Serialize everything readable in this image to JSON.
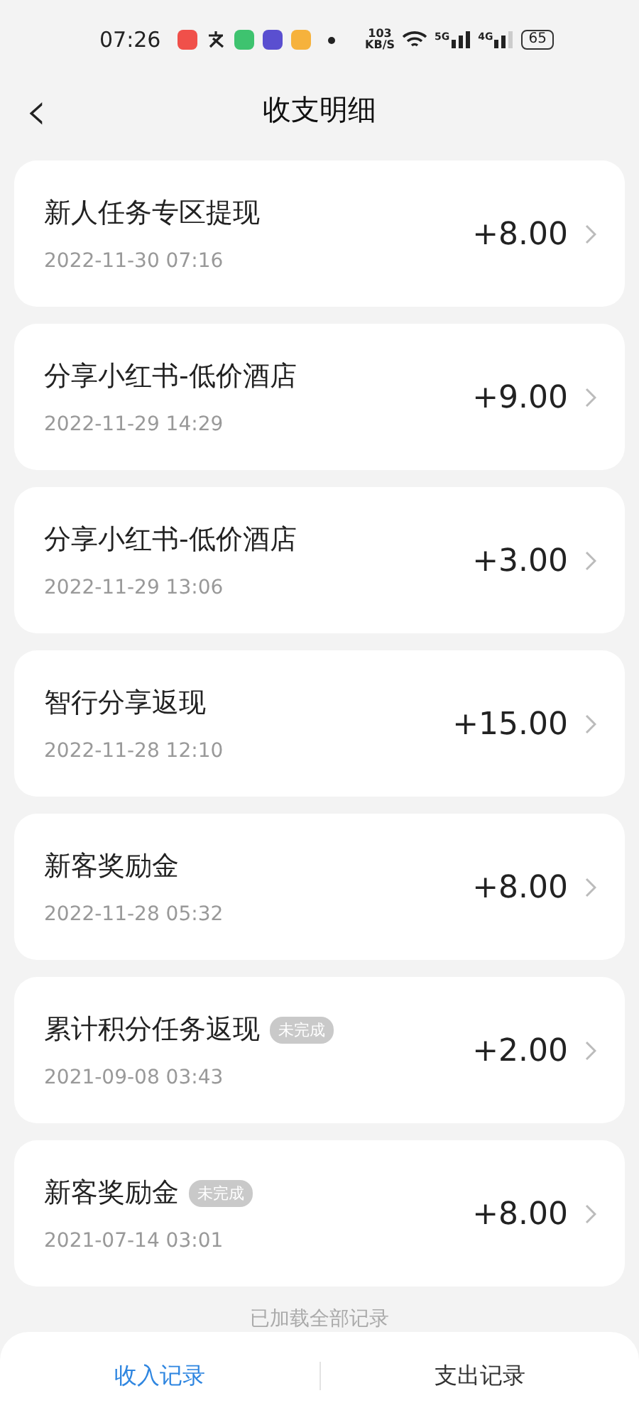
{
  "status_bar": {
    "time": "07:26",
    "speed": "103",
    "speed_unit": "KB/S",
    "network_1": "5G",
    "network_2": "4G",
    "battery": "65"
  },
  "header": {
    "back": "‹",
    "title": "收支明细"
  },
  "records": [
    {
      "title": "新人任务专区提现",
      "time": "2022-11-30 07:16",
      "amount": "+8.00"
    },
    {
      "title": "分享小红书-低价酒店",
      "time": "2022-11-29 14:29",
      "amount": "+9.00"
    },
    {
      "title": "分享小红书-低价酒店",
      "time": "2022-11-29 13:06",
      "amount": "+3.00"
    },
    {
      "title": "智行分享返现",
      "time": "2022-11-28 12:10",
      "amount": "+15.00"
    },
    {
      "title": "新客奖励金",
      "time": "2022-11-28 05:32",
      "amount": "+8.00"
    },
    {
      "title": "累计积分任务返现",
      "badge": "未完成",
      "time": "2021-09-08 03:43",
      "amount": "+2.00"
    },
    {
      "title": "新客奖励金",
      "badge": "未完成",
      "time": "2021-07-14 03:01",
      "amount": "+8.00"
    }
  ],
  "footer_note": "已加载全部记录",
  "bottom_tabs": [
    {
      "label": "收入记录",
      "selected": true
    },
    {
      "label": "支出记录",
      "selected": false
    }
  ]
}
